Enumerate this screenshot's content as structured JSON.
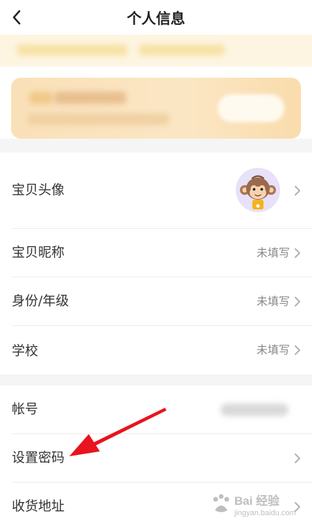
{
  "header": {
    "title": "个人信息",
    "back_icon": "chevron-left-icon"
  },
  "promo": {
    "accent_color": "#fae0b8"
  },
  "profile_rows": [
    {
      "label": "宝贝头像",
      "value": "",
      "icon": "avatar-monkey-icon"
    },
    {
      "label": "宝贝昵称",
      "value": "未填写"
    },
    {
      "label": "身份/年级",
      "value": "未填写"
    },
    {
      "label": "学校",
      "value": "未填写"
    }
  ],
  "account_rows": [
    {
      "label": "帐号",
      "value": ""
    },
    {
      "label": "设置密码",
      "value": ""
    },
    {
      "label": "收货地址",
      "value": ""
    }
  ],
  "annotation": {
    "arrow_color": "#e8141e"
  },
  "watermark": {
    "brand": "Bai 经验",
    "url": "jingyan.baidu.com",
    "icon": "baidu-paw-icon"
  }
}
